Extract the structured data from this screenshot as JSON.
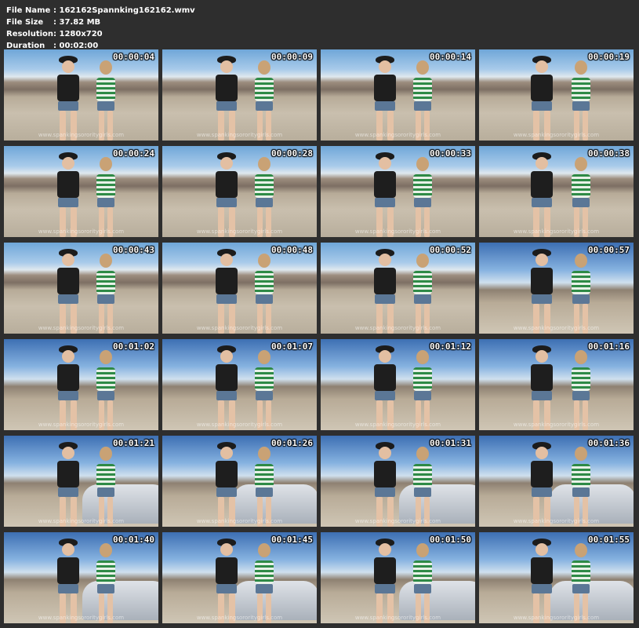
{
  "info": {
    "rows": [
      {
        "key": "File Name",
        "value": ":  162162Spannking162162.wmv"
      },
      {
        "key": "File Size",
        "value": ":  37.82 MB"
      },
      {
        "key": "Resolution",
        "value": ":  1280x720"
      },
      {
        "key": "Duration",
        "value": ":  00:02:00"
      }
    ]
  },
  "watermark": "www.spankingsororitygirls.com",
  "thumbnails": [
    {
      "time": "00:00:04"
    },
    {
      "time": "00:00:09"
    },
    {
      "time": "00:00:14"
    },
    {
      "time": "00:00:19"
    },
    {
      "time": "00:00:24"
    },
    {
      "time": "00:00:28"
    },
    {
      "time": "00:00:33"
    },
    {
      "time": "00:00:38"
    },
    {
      "time": "00:00:43"
    },
    {
      "time": "00:00:48"
    },
    {
      "time": "00:00:52"
    },
    {
      "time": "00:00:57"
    },
    {
      "time": "00:01:02"
    },
    {
      "time": "00:01:07"
    },
    {
      "time": "00:01:12"
    },
    {
      "time": "00:01:16"
    },
    {
      "time": "00:01:21"
    },
    {
      "time": "00:01:26"
    },
    {
      "time": "00:01:31"
    },
    {
      "time": "00:01:36"
    },
    {
      "time": "00:01:40"
    },
    {
      "time": "00:01:45"
    },
    {
      "time": "00:01:50"
    },
    {
      "time": "00:01:55"
    }
  ]
}
